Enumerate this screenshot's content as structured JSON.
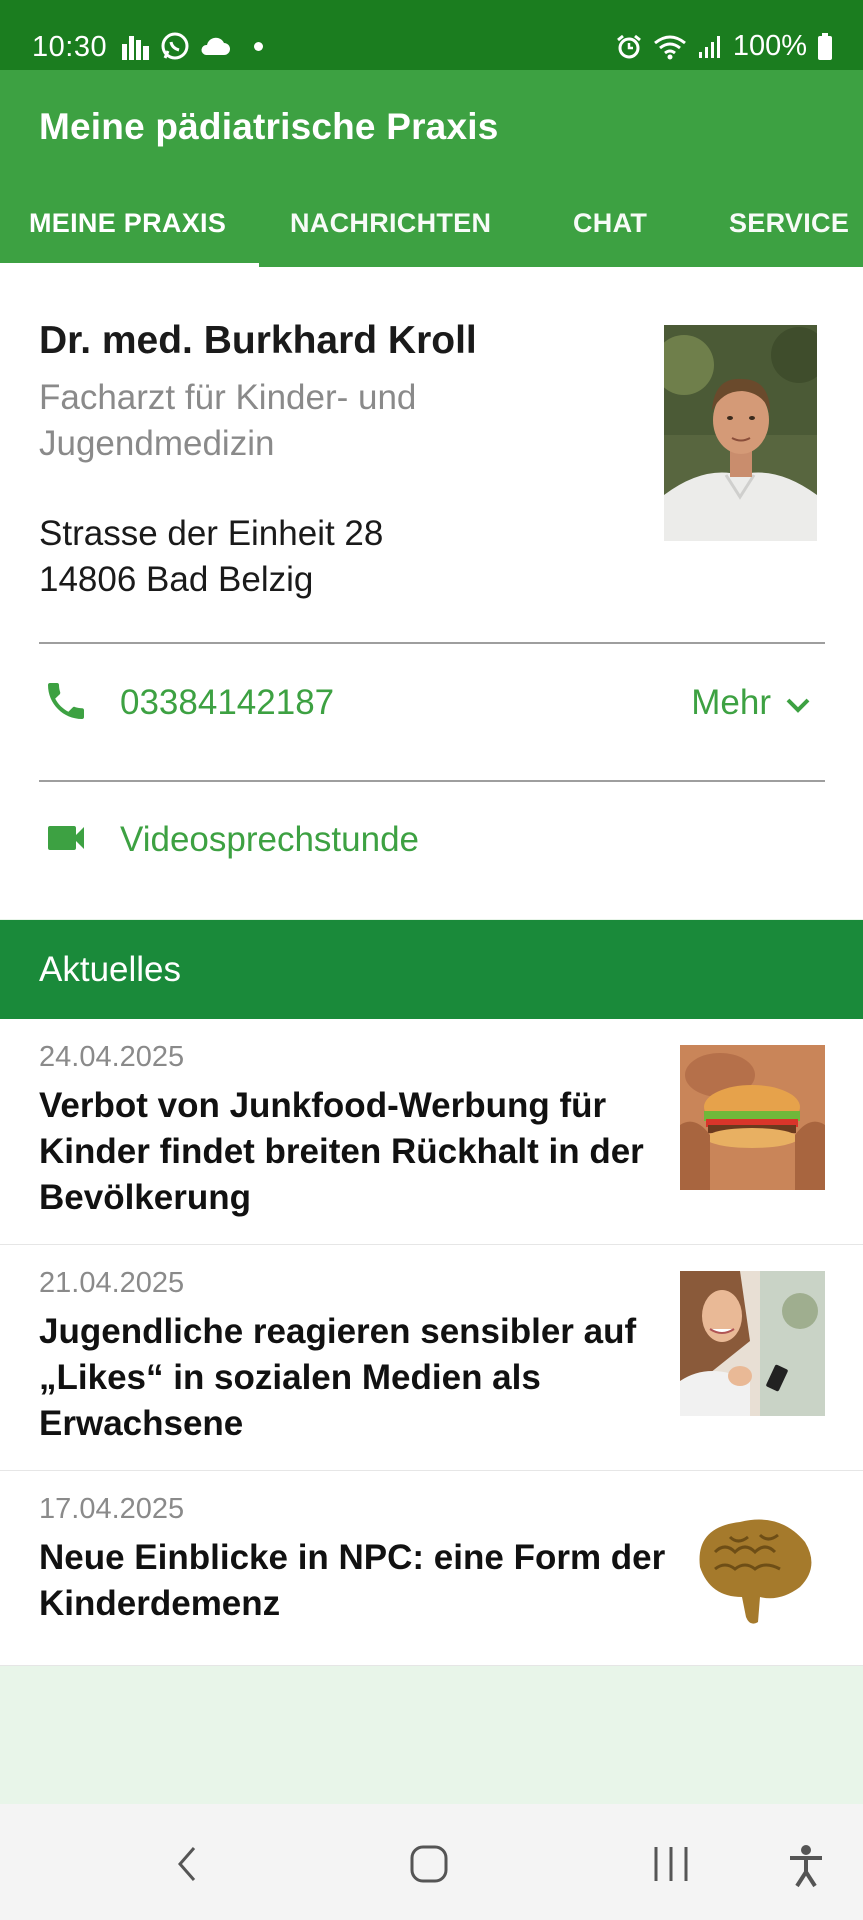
{
  "status_bar": {
    "time": "10:30",
    "battery": "100%"
  },
  "app": {
    "title": "Meine pädiatrische Praxis",
    "tabs": [
      {
        "label": "MEINE PRAXIS",
        "active": true
      },
      {
        "label": "NACHRICHTEN",
        "active": false
      },
      {
        "label": "CHAT",
        "active": false
      },
      {
        "label": "SERVICE",
        "active": false
      }
    ]
  },
  "doctor": {
    "name": "Dr. med. Burkhard Kroll",
    "specialty_line1": "Facharzt für Kinder- und",
    "specialty_line2": "Jugendmedizin",
    "street": "Strasse der Einheit 28",
    "city": "14806 Bad Belzig",
    "phone": "03384142187",
    "more_label": "Mehr",
    "video_label": "Videosprechstunde"
  },
  "news_section": {
    "header": "Aktuelles",
    "items": [
      {
        "date": "24.04.2025",
        "title": "Verbot von Junkfood-Werbung für Kinder findet breiten Rückhalt in der Bevölkerung"
      },
      {
        "date": "21.04.2025",
        "title": "Jugendliche reagieren sensibler auf „Likes“ in sozialen Medien als Erwachsene"
      },
      {
        "date": "17.04.2025",
        "title": "Neue Einblicke in NPC: eine Form der Kinderdemenz"
      }
    ]
  },
  "colors": {
    "status_bar": "#1b7d1f",
    "app_bar": "#3da142",
    "section_header": "#1a8a3a",
    "accent_text": "#3da142",
    "page_bg": "#e8f5e9"
  },
  "icons": {
    "phone": "phone-icon",
    "video": "videocam-icon",
    "more": "chevron-down-icon",
    "nav_back": "back-icon",
    "nav_home": "home-icon",
    "nav_recents": "recents-icon",
    "accessibility": "accessibility-icon"
  }
}
